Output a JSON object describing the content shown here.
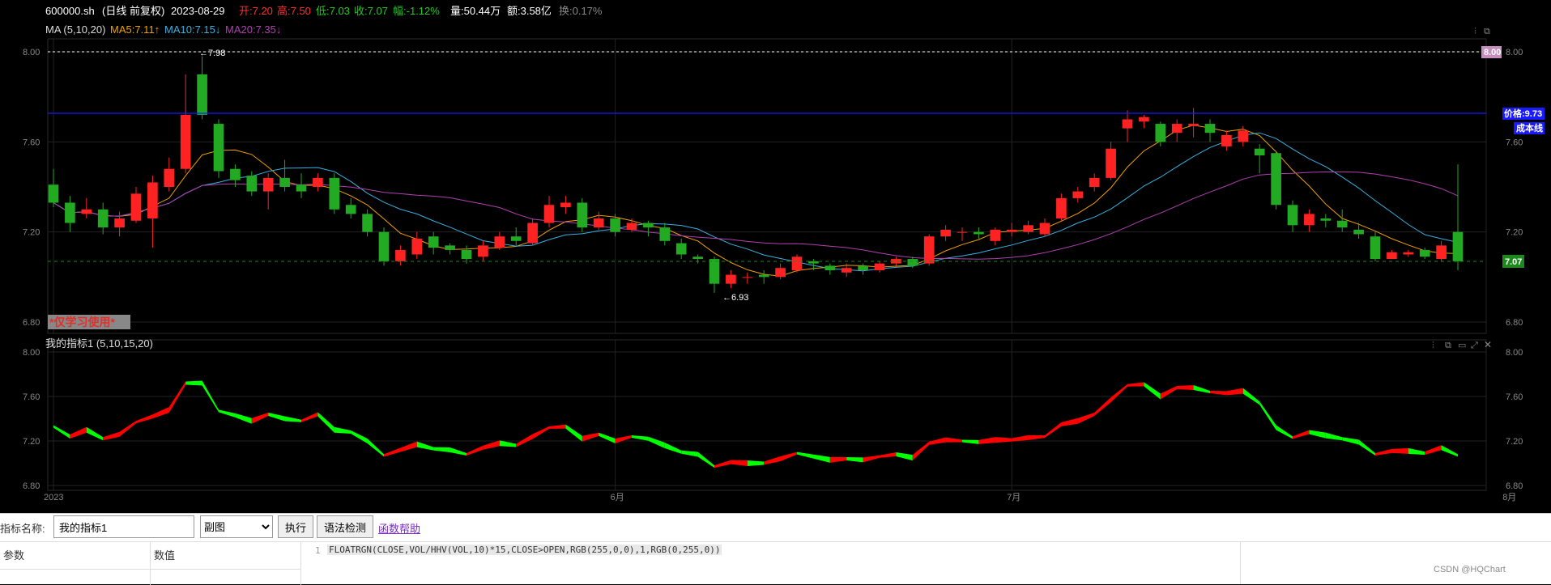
{
  "header": {
    "symbol": "600000.sh",
    "period": "(日线 前复权)",
    "date": "2023-08-29",
    "open": "开:7.20",
    "high": "高:7.50",
    "low": "低:7.03",
    "close": "收:7.07",
    "change": "幅:-1.12%",
    "volume": "量:50.44万",
    "amount": "额:3.58亿",
    "turnover": "换:0.17%"
  },
  "ma_legend": {
    "title": "MA (5,10,20)",
    "ma5": "MA5:7.11↑",
    "ma10": "MA10:7.15↓",
    "ma20": "MA20:7.35↓"
  },
  "main_axis": {
    "ticks": [
      "8.00",
      "7.60",
      "7.20",
      "6.80"
    ]
  },
  "main_markers": {
    "high_label": "←7.98",
    "low_label": "←6.93",
    "max_price_tag": "8.00",
    "cost_price_tag": "价格:9.73",
    "cost_line_tag": "成本线",
    "last_price_tag": "7.07",
    "watermark": "*仅学习使用*"
  },
  "indicator": {
    "title": "我的指标1 (5,10,15,20)",
    "ticks": [
      "8.00",
      "7.60",
      "7.20",
      "6.80"
    ]
  },
  "x_axis": {
    "labels": [
      "2023",
      "6月",
      "7月",
      "8月"
    ]
  },
  "editor": {
    "name_label": "指标名称:",
    "name_value": "我的指标1",
    "type_selected": "副图",
    "run_button": "执行",
    "check_button": "语法检测",
    "help_link": "函数帮助",
    "col_param": "参数",
    "col_value": "数值",
    "line_no": "1",
    "code": "FLOATRGN(CLOSE,VOL/HHV(VOL,10)*15,CLOSE>OPEN,RGB(255,0,0),1,RGB(0,255,0))",
    "credit": "CSDN @HQChart"
  },
  "colors": {
    "up": "#ff2222",
    "down": "#22aa22",
    "ma5": "#f0a000",
    "ma10": "#3ab0e0",
    "ma20": "#b040b0",
    "float_up": "#ff0000",
    "float_down": "#00ff00"
  },
  "chart_data": {
    "type": "candlestick",
    "y_range": [
      6.8,
      8.0
    ],
    "candles": [
      [
        7.41,
        7.33,
        7.48,
        7.31
      ],
      [
        7.33,
        7.24,
        7.36,
        7.2
      ],
      [
        7.28,
        7.3,
        7.35,
        7.26
      ],
      [
        7.3,
        7.22,
        7.33,
        7.19
      ],
      [
        7.22,
        7.26,
        7.29,
        7.18
      ],
      [
        7.25,
        7.37,
        7.4,
        7.24
      ],
      [
        7.26,
        7.42,
        7.45,
        7.13
      ],
      [
        7.4,
        7.48,
        7.53,
        7.38
      ],
      [
        7.48,
        7.72,
        7.9,
        7.46
      ],
      [
        7.9,
        7.72,
        7.98,
        7.7
      ],
      [
        7.68,
        7.47,
        7.7,
        7.44
      ],
      [
        7.48,
        7.43,
        7.5,
        7.4
      ],
      [
        7.45,
        7.38,
        7.47,
        7.36
      ],
      [
        7.38,
        7.44,
        7.46,
        7.3
      ],
      [
        7.44,
        7.4,
        7.52,
        7.38
      ],
      [
        7.41,
        7.38,
        7.46,
        7.35
      ],
      [
        7.4,
        7.44,
        7.46,
        7.38
      ],
      [
        7.44,
        7.3,
        7.46,
        7.28
      ],
      [
        7.32,
        7.28,
        7.35,
        7.26
      ],
      [
        7.28,
        7.2,
        7.3,
        7.18
      ],
      [
        7.2,
        7.07,
        7.22,
        7.05
      ],
      [
        7.07,
        7.12,
        7.14,
        7.05
      ],
      [
        7.1,
        7.17,
        7.2,
        7.08
      ],
      [
        7.18,
        7.13,
        7.2,
        7.1
      ],
      [
        7.14,
        7.12,
        7.15,
        7.1
      ],
      [
        7.12,
        7.08,
        7.14,
        7.06
      ],
      [
        7.09,
        7.14,
        7.16,
        7.07
      ],
      [
        7.13,
        7.18,
        7.2,
        7.12
      ],
      [
        7.18,
        7.16,
        7.22,
        7.14
      ],
      [
        7.15,
        7.24,
        7.26,
        7.14
      ],
      [
        7.24,
        7.32,
        7.36,
        7.22
      ],
      [
        7.31,
        7.33,
        7.36,
        7.28
      ],
      [
        7.33,
        7.22,
        7.35,
        7.2
      ],
      [
        7.22,
        7.26,
        7.29,
        7.21
      ],
      [
        7.26,
        7.2,
        7.28,
        7.18
      ],
      [
        7.21,
        7.24,
        7.26,
        7.2
      ],
      [
        7.24,
        7.22,
        7.25,
        7.18
      ],
      [
        7.22,
        7.16,
        7.24,
        7.14
      ],
      [
        7.15,
        7.1,
        7.17,
        7.08
      ],
      [
        7.09,
        7.08,
        7.1,
        7.06
      ],
      [
        7.08,
        6.97,
        7.09,
        6.93
      ],
      [
        6.97,
        7.01,
        7.03,
        6.95
      ],
      [
        7.0,
        7.0,
        7.02,
        6.97
      ],
      [
        7.01,
        7.0,
        7.03,
        6.97
      ],
      [
        7.0,
        7.04,
        7.06,
        6.99
      ],
      [
        7.03,
        7.09,
        7.1,
        7.02
      ],
      [
        7.07,
        7.06,
        7.08,
        7.03
      ],
      [
        7.05,
        7.03,
        7.06,
        7.01
      ],
      [
        7.02,
        7.04,
        7.06,
        7.0
      ],
      [
        7.05,
        7.03,
        7.06,
        7.01
      ],
      [
        7.03,
        7.06,
        7.07,
        7.02
      ],
      [
        7.06,
        7.08,
        7.09,
        7.05
      ],
      [
        7.08,
        7.05,
        7.09,
        7.04
      ],
      [
        7.06,
        7.18,
        7.19,
        7.05
      ],
      [
        7.18,
        7.21,
        7.23,
        7.16
      ],
      [
        7.2,
        7.2,
        7.22,
        7.16
      ],
      [
        7.2,
        7.19,
        7.22,
        7.17
      ],
      [
        7.16,
        7.21,
        7.22,
        7.14
      ],
      [
        7.2,
        7.21,
        7.24,
        7.18
      ],
      [
        7.2,
        7.23,
        7.25,
        7.19
      ],
      [
        7.19,
        7.24,
        7.26,
        7.18
      ],
      [
        7.26,
        7.35,
        7.37,
        7.25
      ],
      [
        7.35,
        7.38,
        7.4,
        7.33
      ],
      [
        7.4,
        7.44,
        7.46,
        7.38
      ],
      [
        7.44,
        7.57,
        7.6,
        7.43
      ],
      [
        7.66,
        7.7,
        7.74,
        7.6
      ],
      [
        7.69,
        7.71,
        7.72,
        7.66
      ],
      [
        7.68,
        7.6,
        7.69,
        7.58
      ],
      [
        7.64,
        7.68,
        7.7,
        7.6
      ],
      [
        7.67,
        7.68,
        7.75,
        7.62
      ],
      [
        7.68,
        7.64,
        7.7,
        7.6
      ],
      [
        7.58,
        7.63,
        7.65,
        7.56
      ],
      [
        7.6,
        7.65,
        7.67,
        7.58
      ],
      [
        7.57,
        7.54,
        7.59,
        7.46
      ],
      [
        7.55,
        7.32,
        7.56,
        7.3
      ],
      [
        7.32,
        7.23,
        7.34,
        7.2
      ],
      [
        7.23,
        7.28,
        7.3,
        7.2
      ],
      [
        7.26,
        7.25,
        7.28,
        7.22
      ],
      [
        7.25,
        7.22,
        7.3,
        7.2
      ],
      [
        7.21,
        7.19,
        7.24,
        7.17
      ],
      [
        7.18,
        7.08,
        7.2,
        7.07
      ],
      [
        7.08,
        7.11,
        7.12,
        7.08
      ],
      [
        7.1,
        7.11,
        7.12,
        7.09
      ],
      [
        7.12,
        7.09,
        7.13,
        7.08
      ],
      [
        7.08,
        7.14,
        7.16,
        7.07
      ],
      [
        7.2,
        7.07,
        7.5,
        7.03
      ]
    ]
  }
}
